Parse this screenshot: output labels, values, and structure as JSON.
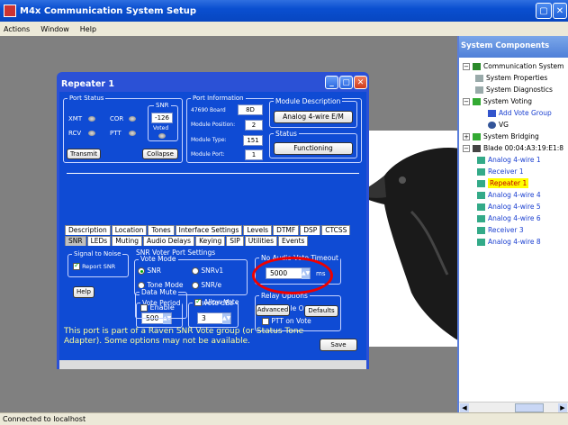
{
  "app": {
    "title": "M4x Communication System Setup",
    "menu": [
      "Actions",
      "Window",
      "Help"
    ],
    "status": "Connected to localhost"
  },
  "sidebar": {
    "title": "System Components",
    "tree": [
      {
        "label": "Communication System",
        "style": "black"
      },
      {
        "label": "System Properties",
        "style": "black"
      },
      {
        "label": "System Diagnostics",
        "style": "black"
      },
      {
        "label": "System Voting",
        "style": "black"
      },
      {
        "label": "Add Vote Group",
        "style": "blue"
      },
      {
        "label": "VG",
        "style": "black"
      },
      {
        "label": "System Bridging",
        "style": "black"
      },
      {
        "label": "Blade 00:04:A3:19:E1:8",
        "style": "black"
      },
      {
        "label": "Analog 4-wire 1",
        "style": "blue"
      },
      {
        "label": "Receiver 1",
        "style": "blue"
      },
      {
        "label": "Repeater 1",
        "style": "selected"
      },
      {
        "label": "Analog 4-wire 4",
        "style": "blue"
      },
      {
        "label": "Analog 4-wire 5",
        "style": "blue"
      },
      {
        "label": "Analog 4-wire 6",
        "style": "blue"
      },
      {
        "label": "Receiver 3",
        "style": "blue"
      },
      {
        "label": "Analog 4-wire 8",
        "style": "blue"
      }
    ]
  },
  "dialog": {
    "title": "Repeater 1",
    "port_status": {
      "label": "Port Status",
      "xmt": "XMT",
      "rcv": "RCV",
      "cor": "COR",
      "ptt": "PTT",
      "snr_label": "SNR",
      "snr_value": "-126",
      "voted": "Voted",
      "transmit": "Transmit",
      "collapse": "Collapse"
    },
    "port_info": {
      "label": "Port Information",
      "board_label": "47690 Board",
      "board_value": "8D",
      "position_label": "Module Position:",
      "position_value": "2",
      "type_label": "Module Type:",
      "type_value": "151",
      "port_label": "Module Port:",
      "port_value": "1",
      "desc_label": "Module Description",
      "desc_value": "Analog 4-wire E/M",
      "status_label": "Status",
      "status_value": "Functioning"
    },
    "tabs_row1": [
      "Description",
      "Location",
      "Tones",
      "Interface Settings",
      "Levels",
      "DTMF",
      "DSP",
      "CTCSS"
    ],
    "tabs_row2": [
      "SNR",
      "LEDs",
      "Muting",
      "Audio Delays",
      "Keying",
      "SIP",
      "Utilities",
      "Events"
    ],
    "snr": {
      "signal_to_noise": "Signal to Noise",
      "report_snr": "Report SNR",
      "help": "Help",
      "voter_settings": "SNR Voter Port Settings",
      "vote_mode": "Vote Mode",
      "opt_snr": "SNR",
      "opt_snrv1": "SNRv1",
      "opt_tone": "Tone Mode",
      "opt_snre": "SNR/e",
      "vote_period": "Vote Period",
      "vote_period_value": "500",
      "unvote_db": "Unvote dBs",
      "unvote_db_value": "3",
      "data_mute": "Data Mute",
      "enable": "Enable",
      "allow_vote": "Allow Vote",
      "no_audio_timeout": "No Audio Vote Timeout",
      "timeout_value": "5000",
      "ms": "ms",
      "relay_options": "Relay Options",
      "disable_on_cor": "Disable On COR",
      "ptt_on_vote": "PTT on Vote",
      "advanced": "Advanced",
      "defaults": "Defaults"
    },
    "footer_text": "This port is part of a Raven SNR Vote group (or Status Tone Adapter). Some options may not be available.",
    "save": "Save"
  }
}
